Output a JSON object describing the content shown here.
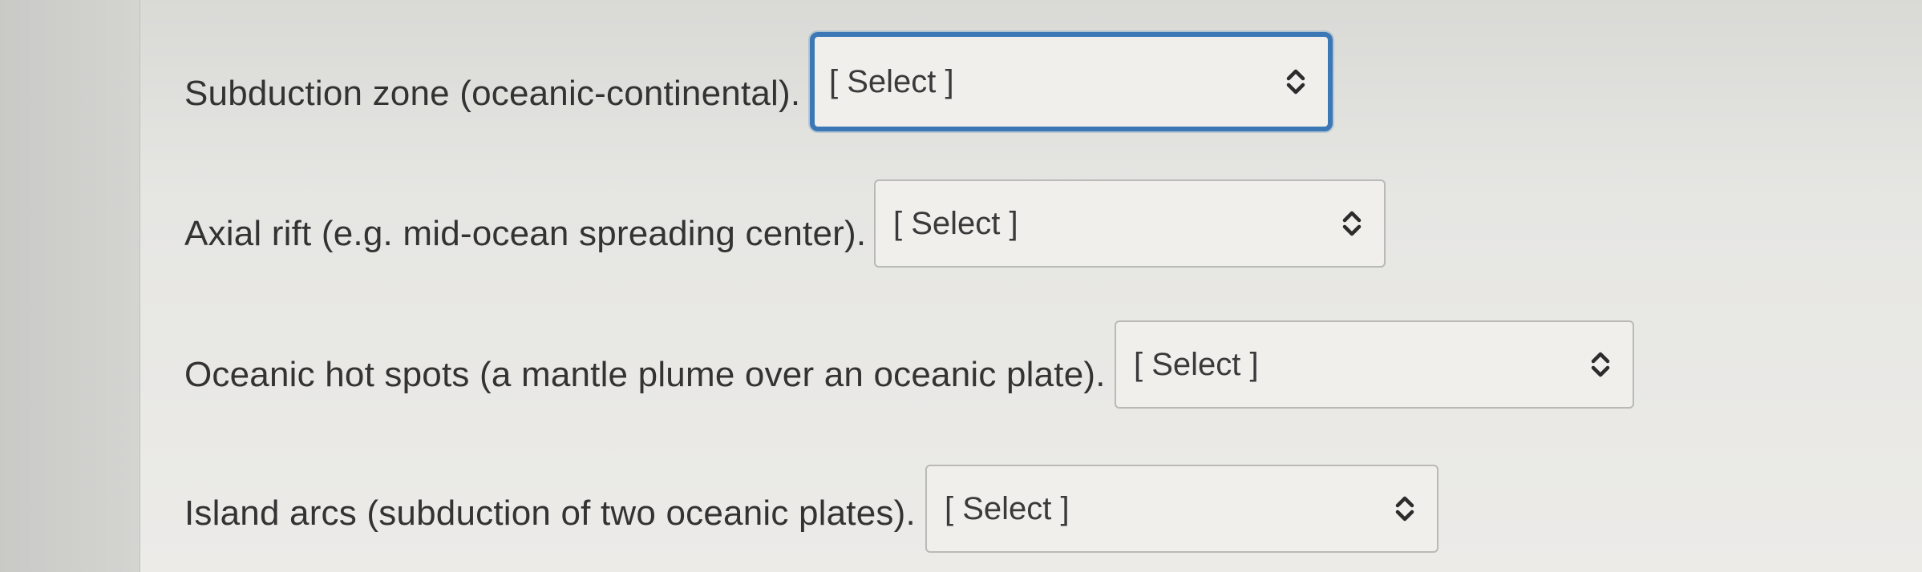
{
  "questions": [
    {
      "label": "Subduction zone (oceanic-continental).",
      "select_value": "[ Select ]",
      "focused": true,
      "icon": "chevron-up-down-icon"
    },
    {
      "label": "Axial rift (e.g. mid-ocean spreading center).",
      "select_value": "[ Select ]",
      "focused": false,
      "icon": "chevron-up-down-icon"
    },
    {
      "label": "Oceanic hot spots (a mantle plume over an oceanic plate).",
      "select_value": "[ Select ]",
      "focused": false,
      "icon": "chevron-up-down-icon"
    },
    {
      "label": "Island arcs (subduction of two oceanic plates).",
      "select_value": "[ Select ]",
      "focused": false,
      "icon": "chevron-up-down-icon"
    }
  ],
  "colors": {
    "focus_border": "#3b78b5",
    "text": "#333333",
    "border": "#b9b9b6"
  }
}
